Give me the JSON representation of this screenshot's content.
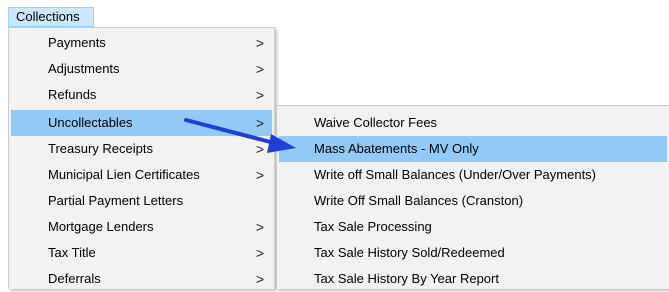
{
  "menubar": {
    "collections_label": "Collections"
  },
  "main_menu": {
    "items": [
      {
        "label": "Payments",
        "submenu": ">"
      },
      {
        "label": "Adjustments",
        "submenu": ">"
      },
      {
        "label": "Refunds",
        "submenu": ">"
      },
      {
        "label": "Uncollectables",
        "submenu": ">"
      },
      {
        "label": "Treasury Receipts",
        "submenu": ">"
      },
      {
        "label": "Municipal Lien Certificates",
        "submenu": ">"
      },
      {
        "label": "Partial Payment Letters",
        "submenu": ""
      },
      {
        "label": "Mortgage Lenders",
        "submenu": ">"
      },
      {
        "label": "Tax Title",
        "submenu": ">"
      },
      {
        "label": "Deferrals",
        "submenu": ">"
      }
    ]
  },
  "sub_menu": {
    "items": [
      {
        "label": "Waive Collector Fees"
      },
      {
        "label": "Mass Abatements - MV Only"
      },
      {
        "label": "Write off Small Balances (Under/Over Payments)"
      },
      {
        "label": "Write Off Small Balances (Cranston)"
      },
      {
        "label": "Tax Sale Processing"
      },
      {
        "label": "Tax Sale History Sold/Redeemed"
      },
      {
        "label": "Tax Sale History By Year Report"
      }
    ]
  },
  "colors": {
    "highlight": "#91c9f7",
    "menubar_active": "#cce8ff",
    "menu_bg": "#f2f2f2",
    "annotation_arrow": "#1f3fd6"
  },
  "annotation": {
    "icon": "arrow-annotation-icon"
  }
}
